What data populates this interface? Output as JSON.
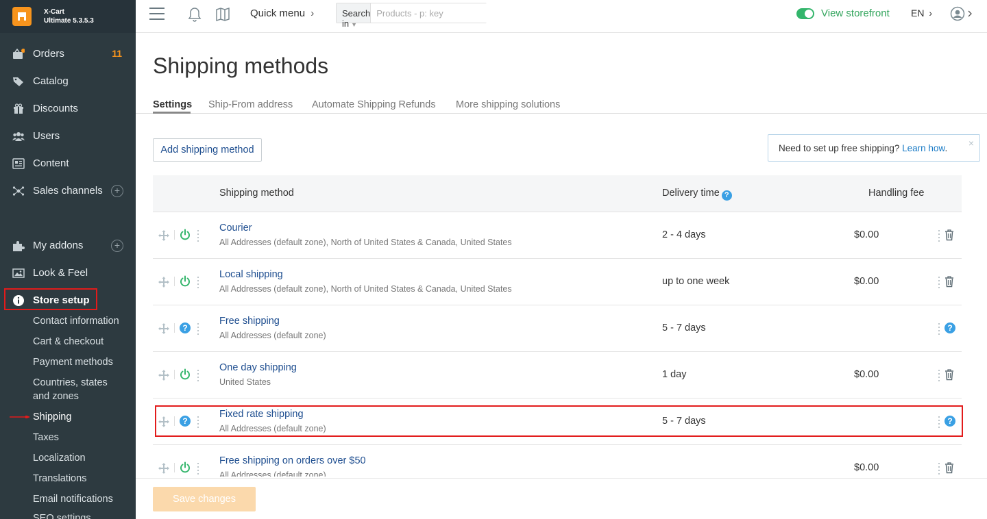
{
  "brand": {
    "name": "X-Cart",
    "edition": "Ultimate 5.3.5.3"
  },
  "sidebar": {
    "items": [
      {
        "label": "Orders",
        "badge": "11",
        "icon": "orders-icon"
      },
      {
        "label": "Catalog",
        "icon": "tag-icon"
      },
      {
        "label": "Discounts",
        "icon": "gift-icon"
      },
      {
        "label": "Users",
        "icon": "users-icon"
      },
      {
        "label": "Content",
        "icon": "content-icon"
      },
      {
        "label": "Sales channels",
        "icon": "network-icon"
      },
      {
        "label": "My addons",
        "icon": "puzzle-icon"
      },
      {
        "label": "Look & Feel",
        "icon": "image-icon"
      },
      {
        "label": "Store setup",
        "icon": "info-icon"
      }
    ],
    "sub_items": [
      "Contact information",
      "Cart & checkout",
      "Payment methods",
      "Countries, states",
      "and zones",
      "Shipping",
      "Taxes",
      "Localization",
      "Translations",
      "Email notifications",
      "SEO settings"
    ],
    "plus": "+"
  },
  "topbar": {
    "quick_menu": "Quick menu",
    "search_in": "Search in",
    "search_placeholder": "Products - p: key",
    "view_storefront": "View storefront",
    "language": "EN"
  },
  "page": {
    "title": "Shipping methods",
    "tabs": [
      "Settings",
      "Ship-From address",
      "Automate Shipping Refunds",
      "More shipping solutions"
    ],
    "add_button": "Add shipping method",
    "notice_text": "Need to set up free shipping?",
    "notice_link": "Learn how",
    "notice_period": ".",
    "notice_close": "×",
    "save_button": "Save changes"
  },
  "table": {
    "headers": {
      "method": "Shipping method",
      "delivery": "Delivery time",
      "fee": "Handling fee",
      "help": "?"
    },
    "rows": [
      {
        "name": "Courier",
        "zones": "All Addresses (default zone), North of United States & Canada, United States",
        "delivery": "2 - 4 days",
        "fee": "$0.00",
        "status": "power",
        "action": "delete"
      },
      {
        "name": "Local shipping",
        "zones": "All Addresses (default zone), North of United States & Canada, United States",
        "delivery": "up to one week",
        "fee": "$0.00",
        "status": "power",
        "action": "delete"
      },
      {
        "name": "Free shipping",
        "zones": "All Addresses (default zone)",
        "delivery": "5 - 7 days",
        "fee": "",
        "status": "help",
        "action": "help"
      },
      {
        "name": "One day shipping",
        "zones": "United States",
        "delivery": "1 day",
        "fee": "$0.00",
        "status": "power",
        "action": "delete"
      },
      {
        "name": "Fixed rate shipping",
        "zones": "All Addresses (default zone)",
        "delivery": "5 - 7 days",
        "fee": "",
        "status": "help",
        "action": "help"
      },
      {
        "name": "Free shipping on orders over $50",
        "zones": "All Addresses (default zone)",
        "delivery": "",
        "fee": "$0.00",
        "status": "power",
        "action": "delete"
      }
    ]
  },
  "colors": {
    "sidebar_bg": "#2d3a40",
    "accent_orange": "#f7941d",
    "link_blue": "#1d4d8f",
    "green": "#33b56b",
    "help_blue": "#3aa0e4",
    "highlight_red": "#e21b1b"
  }
}
